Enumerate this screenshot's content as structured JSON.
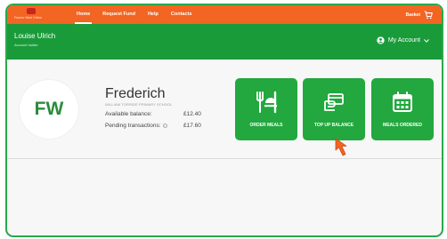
{
  "topbar": {
    "logo_text": "Fischer Meal Online",
    "nav": [
      "Home",
      "Request Fund",
      "Help",
      "Contacts"
    ],
    "basket_label": "Basket"
  },
  "header": {
    "user_name": "Louise Ulrich",
    "user_role": "Account holder",
    "account_label": "My Account"
  },
  "profile": {
    "initials": "FW",
    "name": "Frederich",
    "school": "WILLIAM TORRIDE PRIMARY SCHOOL",
    "available_label": "Available balance:",
    "available_value": "£12.40",
    "pending_label": "Pending transactions:",
    "pending_value": "£17.60"
  },
  "tiles": {
    "order_meals": "ORDER MEALS",
    "top_up": "TOP UP BALANCE",
    "meals_ordered": "MEALS ORDERED"
  },
  "colors": {
    "orange": "#f26522",
    "green": "#1a9b3a",
    "tile_green": "#22a83e",
    "cursor": "#f26522"
  }
}
